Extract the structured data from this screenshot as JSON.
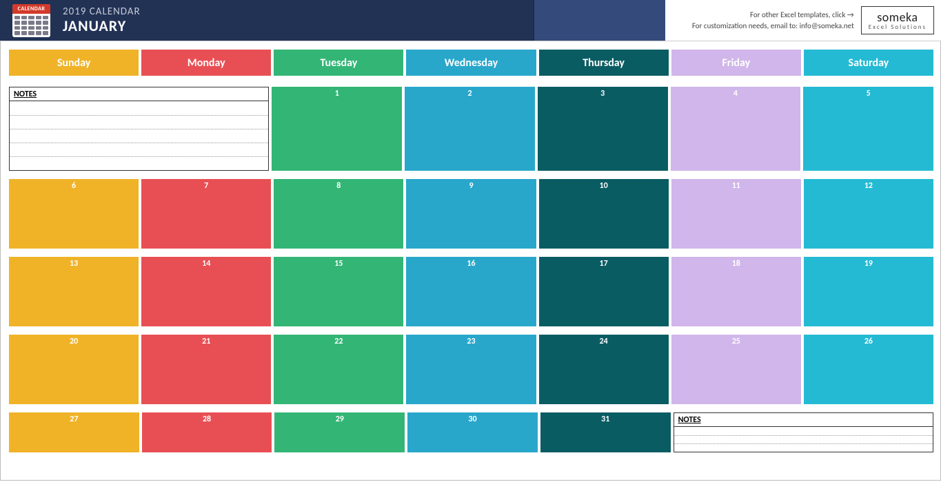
{
  "banner": {
    "icon_label": "CALENDAR",
    "year_line": "2019 CALENDAR",
    "month": "JANUARY",
    "help_line1": "For other Excel templates, click →",
    "help_line2": "For customization needs, email to: info@someka.net",
    "logo_main": "someka",
    "logo_sub": "Excel Solutions"
  },
  "days": {
    "sun": "Sunday",
    "mon": "Monday",
    "tue": "Tuesday",
    "wed": "Wednesday",
    "thu": "Thursday",
    "fri": "Friday",
    "sat": "Saturday"
  },
  "notes_label": "NOTES",
  "weeks": [
    {
      "type": "first",
      "cells": [
        {
          "kind": "notes"
        },
        {
          "kind": "day",
          "num": "1",
          "cls": "c-tue"
        },
        {
          "kind": "day",
          "num": "2",
          "cls": "c-wed"
        },
        {
          "kind": "day",
          "num": "3",
          "cls": "c-thu"
        },
        {
          "kind": "day",
          "num": "4",
          "cls": "c-fri"
        },
        {
          "kind": "day",
          "num": "5",
          "cls": "c-sat"
        }
      ]
    },
    {
      "type": "normal",
      "cells": [
        {
          "kind": "day",
          "num": "6",
          "cls": "c-sun"
        },
        {
          "kind": "day",
          "num": "7",
          "cls": "c-mon"
        },
        {
          "kind": "day",
          "num": "8",
          "cls": "c-tue"
        },
        {
          "kind": "day",
          "num": "9",
          "cls": "c-wed"
        },
        {
          "kind": "day",
          "num": "10",
          "cls": "c-thu"
        },
        {
          "kind": "day",
          "num": "11",
          "cls": "c-fri"
        },
        {
          "kind": "day",
          "num": "12",
          "cls": "c-sat"
        }
      ]
    },
    {
      "type": "normal",
      "cells": [
        {
          "kind": "day",
          "num": "13",
          "cls": "c-sun"
        },
        {
          "kind": "day",
          "num": "14",
          "cls": "c-mon"
        },
        {
          "kind": "day",
          "num": "15",
          "cls": "c-tue"
        },
        {
          "kind": "day",
          "num": "16",
          "cls": "c-wed"
        },
        {
          "kind": "day",
          "num": "17",
          "cls": "c-thu"
        },
        {
          "kind": "day",
          "num": "18",
          "cls": "c-fri"
        },
        {
          "kind": "day",
          "num": "19",
          "cls": "c-sat"
        }
      ]
    },
    {
      "type": "normal",
      "cells": [
        {
          "kind": "day",
          "num": "20",
          "cls": "c-sun"
        },
        {
          "kind": "day",
          "num": "21",
          "cls": "c-mon"
        },
        {
          "kind": "day",
          "num": "22",
          "cls": "c-tue"
        },
        {
          "kind": "day",
          "num": "23",
          "cls": "c-wed"
        },
        {
          "kind": "day",
          "num": "24",
          "cls": "c-thu"
        },
        {
          "kind": "day",
          "num": "25",
          "cls": "c-fri"
        },
        {
          "kind": "day",
          "num": "26",
          "cls": "c-sat"
        }
      ]
    },
    {
      "type": "last",
      "cells": [
        {
          "kind": "day",
          "num": "27",
          "cls": "c-sun"
        },
        {
          "kind": "day",
          "num": "28",
          "cls": "c-mon"
        },
        {
          "kind": "day",
          "num": "29",
          "cls": "c-tue"
        },
        {
          "kind": "day",
          "num": "30",
          "cls": "c-wed"
        },
        {
          "kind": "day",
          "num": "31",
          "cls": "c-thu"
        },
        {
          "kind": "notes"
        }
      ]
    }
  ]
}
